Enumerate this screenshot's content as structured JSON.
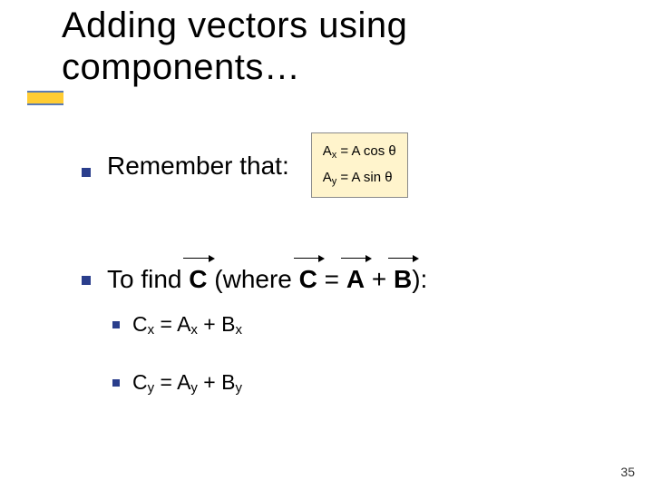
{
  "title_line1": "Adding vectors using",
  "title_line2": "components…",
  "remember_label": "Remember that:",
  "formula": {
    "ax": "A<sub>x</sub> = A cos θ",
    "ay": "A<sub>y</sub> = A sin θ"
  },
  "tofind": {
    "prefix": "To find ",
    "c": "C",
    "mid": " (where ",
    "c2": "C",
    "eq": " = ",
    "a": "A",
    "plus": " + ",
    "b": "B",
    "suffix": "):"
  },
  "subitems": {
    "cx": "C<sub>x</sub> = A<sub>x</sub> + B<sub>x</sub>",
    "cy": "C<sub>y</sub> = A<sub>y</sub> + B<sub>y</sub>"
  },
  "page_number": "35"
}
